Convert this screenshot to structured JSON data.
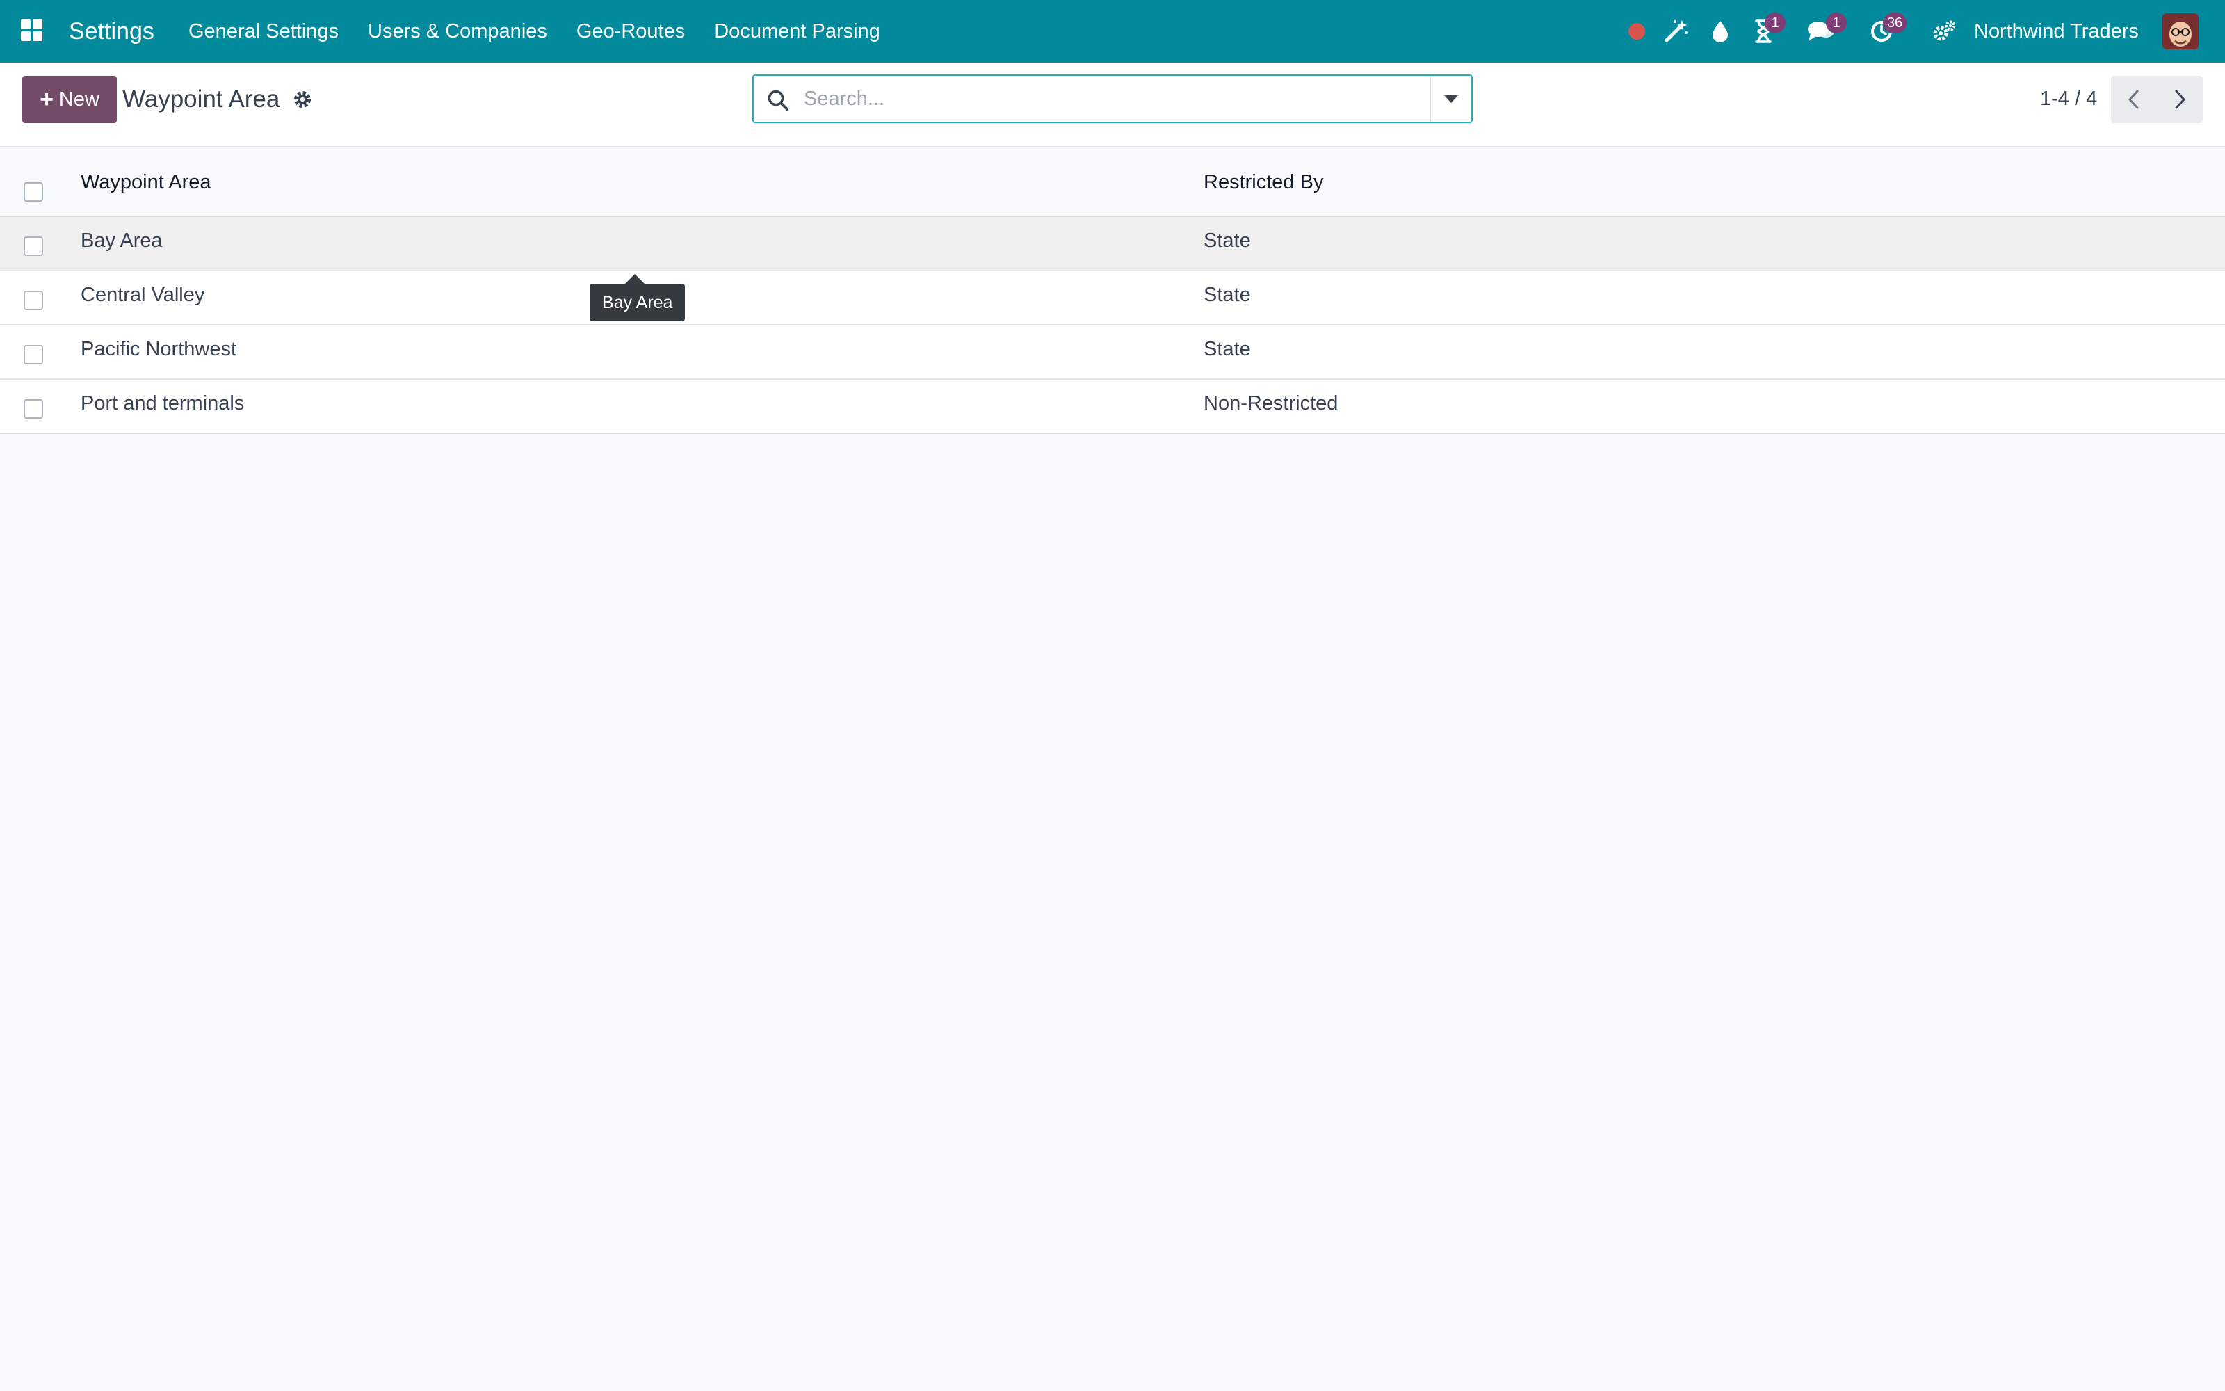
{
  "navbar": {
    "app_name": "Settings",
    "menu": [
      {
        "label": "General Settings"
      },
      {
        "label": "Users & Companies"
      },
      {
        "label": "Geo-Routes"
      },
      {
        "label": "Document Parsing"
      }
    ],
    "systray": {
      "record_icon": "record-icon",
      "magic_icon": "magic-wand-icon",
      "drop_icon": "water-drop-icon",
      "activity_icon": "hourglass-icon",
      "activity_count": "1",
      "messages_icon": "chat-icon",
      "messages_count": "1",
      "clock_icon": "clock-icon",
      "clock_count": "36",
      "settings_icon": "gears-icon",
      "company": "Northwind Traders"
    },
    "colors": {
      "bar": "#028a9c",
      "badge": "#7e3d74",
      "record_dot": "#d9534f"
    }
  },
  "control_panel": {
    "new_label": "New",
    "breadcrumb": "Waypoint Area",
    "search": {
      "placeholder": "Search..."
    },
    "pager": {
      "value": "1-4 / 4"
    },
    "colors": {
      "primary": "#714b67",
      "search_border": "#22b0c0"
    }
  },
  "list": {
    "columns": {
      "name": "Waypoint Area",
      "restricted_by": "Restricted By"
    },
    "rows": [
      {
        "name": "Bay Area",
        "restricted_by": "State"
      },
      {
        "name": "Central Valley",
        "restricted_by": "State"
      },
      {
        "name": "Pacific Northwest",
        "restricted_by": "State"
      },
      {
        "name": "Port and terminals",
        "restricted_by": "Non-Restricted"
      }
    ]
  },
  "tooltip": {
    "text": "Bay Area"
  }
}
